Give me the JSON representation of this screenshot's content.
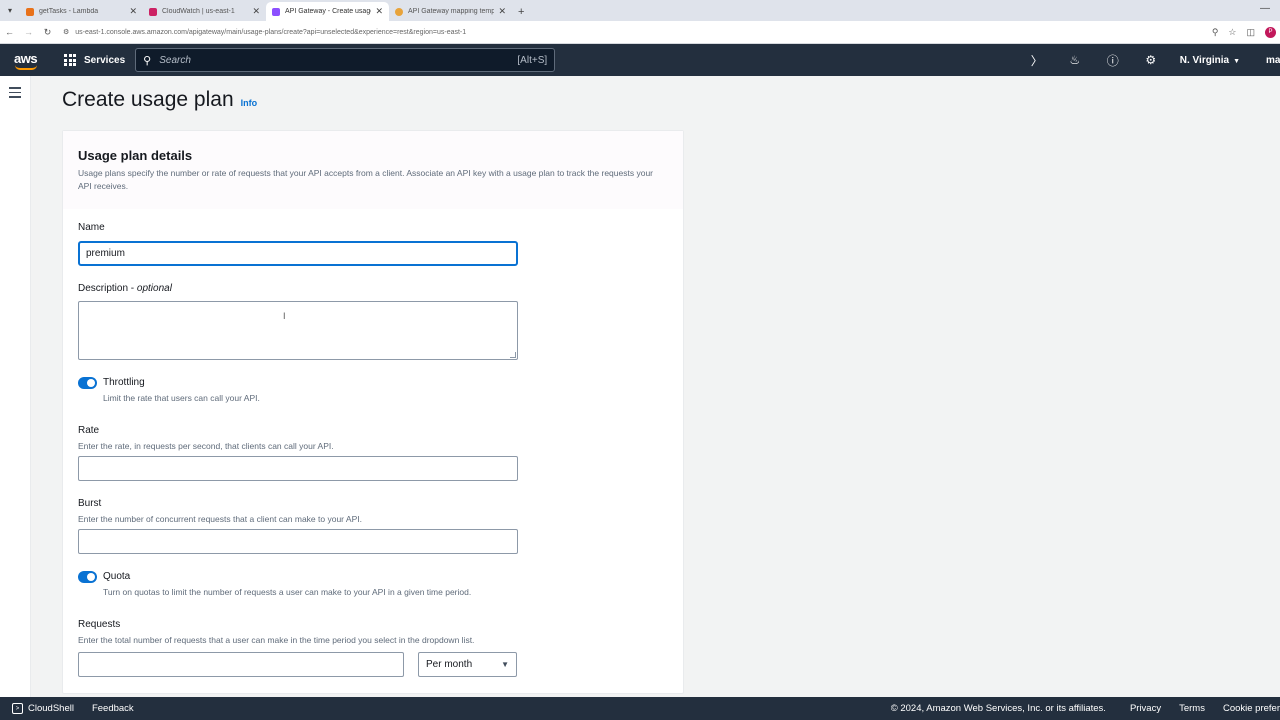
{
  "browser": {
    "tabs": [
      {
        "title": "getTasks - Lambda",
        "color": "#e8711a",
        "active": false
      },
      {
        "title": "CloudWatch | us-east-1",
        "color": "#cc2264",
        "active": false
      },
      {
        "title": "API Gateway - Create usage pla",
        "color": "#8c4fff",
        "active": true
      },
      {
        "title": "API Gateway mapping templat",
        "color": "#e8a33a",
        "active": false
      }
    ],
    "url": "us-east-1.console.aws.amazon.com/apigateway/main/usage-plans/create?api=unselected&experience=rest&region=us-east-1",
    "profile_initial": "P"
  },
  "awsnav": {
    "logo": "aws",
    "services_label": "Services",
    "search_placeholder": "Search",
    "search_shortcut": "[Alt+S]",
    "region": "N. Virginia",
    "account": "ma"
  },
  "page": {
    "title": "Create usage plan",
    "info": "Info"
  },
  "panel": {
    "title": "Usage plan details",
    "description": "Usage plans specify the number or rate of requests that your API accepts from a client. Associate an API key with a usage plan to track the requests your API receives."
  },
  "form": {
    "name_label": "Name",
    "name_value": "premium",
    "description_label": "Description - ",
    "description_optional": "optional",
    "throttling_label": "Throttling",
    "throttling_desc": "Limit the rate that users can call your API.",
    "rate_label": "Rate",
    "rate_desc": "Enter the rate, in requests per second, that clients can call your API.",
    "burst_label": "Burst",
    "burst_desc": "Enter the number of concurrent requests that a client can make to your API.",
    "quota_label": "Quota",
    "quota_desc": "Turn on quotas to limit the number of requests a user can make to your API in a given time period.",
    "requests_label": "Requests",
    "requests_desc": "Enter the total number of requests that a user can make in the time period you select in the dropdown list.",
    "period_selected": "Per month"
  },
  "footer": {
    "cloudshell": "CloudShell",
    "feedback": "Feedback",
    "copyright": "© 2024, Amazon Web Services, Inc. or its affiliates.",
    "privacy": "Privacy",
    "terms": "Terms",
    "cookies": "Cookie prefer"
  }
}
